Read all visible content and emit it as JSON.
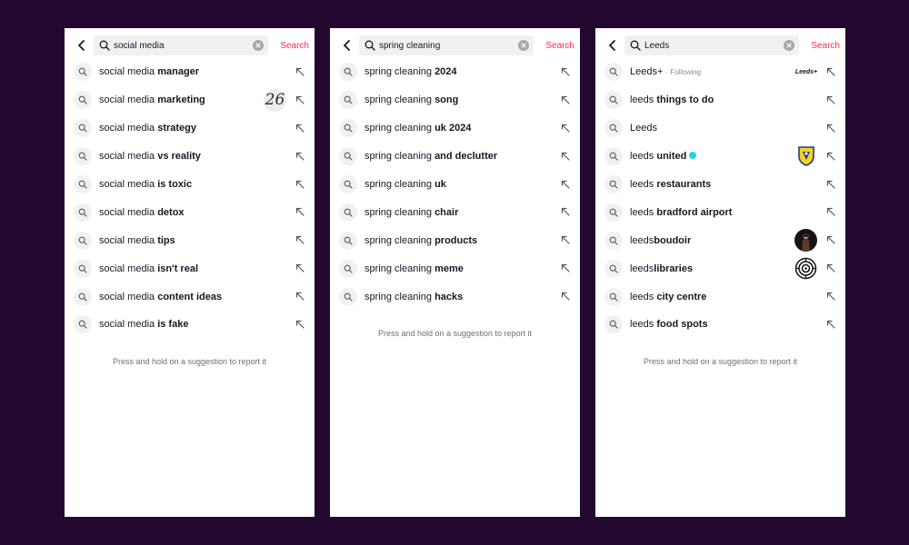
{
  "ui": {
    "search_button": "Search",
    "footer_note": "Press and hold on a suggestion to report it"
  },
  "colors": {
    "background": "#24072f",
    "accent": "#fe2c55",
    "verified": "#20d5ec"
  },
  "icons": {
    "back": "chevron-left-icon",
    "search": "search-icon",
    "clear": "clear-icon",
    "fill": "arrow-up-left-icon"
  },
  "panels": [
    {
      "query": "social media",
      "suggestions": [
        {
          "prefix": "social media ",
          "bold": "manager"
        },
        {
          "prefix": "social media ",
          "bold": "marketing",
          "thumb_text": "26"
        },
        {
          "prefix": "social media ",
          "bold": "strategy"
        },
        {
          "prefix": "social media ",
          "bold": "vs reality"
        },
        {
          "prefix": "social media ",
          "bold": "is toxic"
        },
        {
          "prefix": "social media ",
          "bold": "detox"
        },
        {
          "prefix": "social media ",
          "bold": "tips"
        },
        {
          "prefix": "social media ",
          "bold": "isn't real"
        },
        {
          "prefix": "social media ",
          "bold": "content ideas"
        },
        {
          "prefix": "social media ",
          "bold": "is fake"
        }
      ]
    },
    {
      "query": "spring cleaning",
      "suggestions": [
        {
          "prefix": "spring cleaning ",
          "bold": "2024"
        },
        {
          "prefix": "spring cleaning ",
          "bold": "song"
        },
        {
          "prefix": "spring cleaning ",
          "bold": "uk 2024"
        },
        {
          "prefix": "spring cleaning ",
          "bold": "and declutter"
        },
        {
          "prefix": "spring cleaning ",
          "bold": "uk"
        },
        {
          "prefix": "spring cleaning ",
          "bold": "chair"
        },
        {
          "prefix": "spring cleaning ",
          "bold": "products"
        },
        {
          "prefix": "spring cleaning ",
          "bold": "meme"
        },
        {
          "prefix": "spring cleaning ",
          "bold": "hacks"
        }
      ]
    },
    {
      "query": "Leeds",
      "suggestions": [
        {
          "prefix": "Leeds+",
          "bold": "",
          "meta": "· Following",
          "thumb_text": "Leeds+",
          "thumb_kind": "logo"
        },
        {
          "prefix": "leeds ",
          "bold": "things to do"
        },
        {
          "prefix": "Leeds",
          "bold": ""
        },
        {
          "prefix": "leeds ",
          "bold": "united",
          "verified": true,
          "thumb_kind": "badge"
        },
        {
          "prefix": "leeds ",
          "bold": "restaurants"
        },
        {
          "prefix": "leeds ",
          "bold": "bradford airport"
        },
        {
          "prefix": "leeds",
          "bold": "boudoir",
          "thumb_kind": "photo"
        },
        {
          "prefix": "leeds",
          "bold": "libraries",
          "thumb_kind": "emblem"
        },
        {
          "prefix": "leeds ",
          "bold": "city centre"
        },
        {
          "prefix": "leeds ",
          "bold": "food spots"
        }
      ]
    }
  ]
}
